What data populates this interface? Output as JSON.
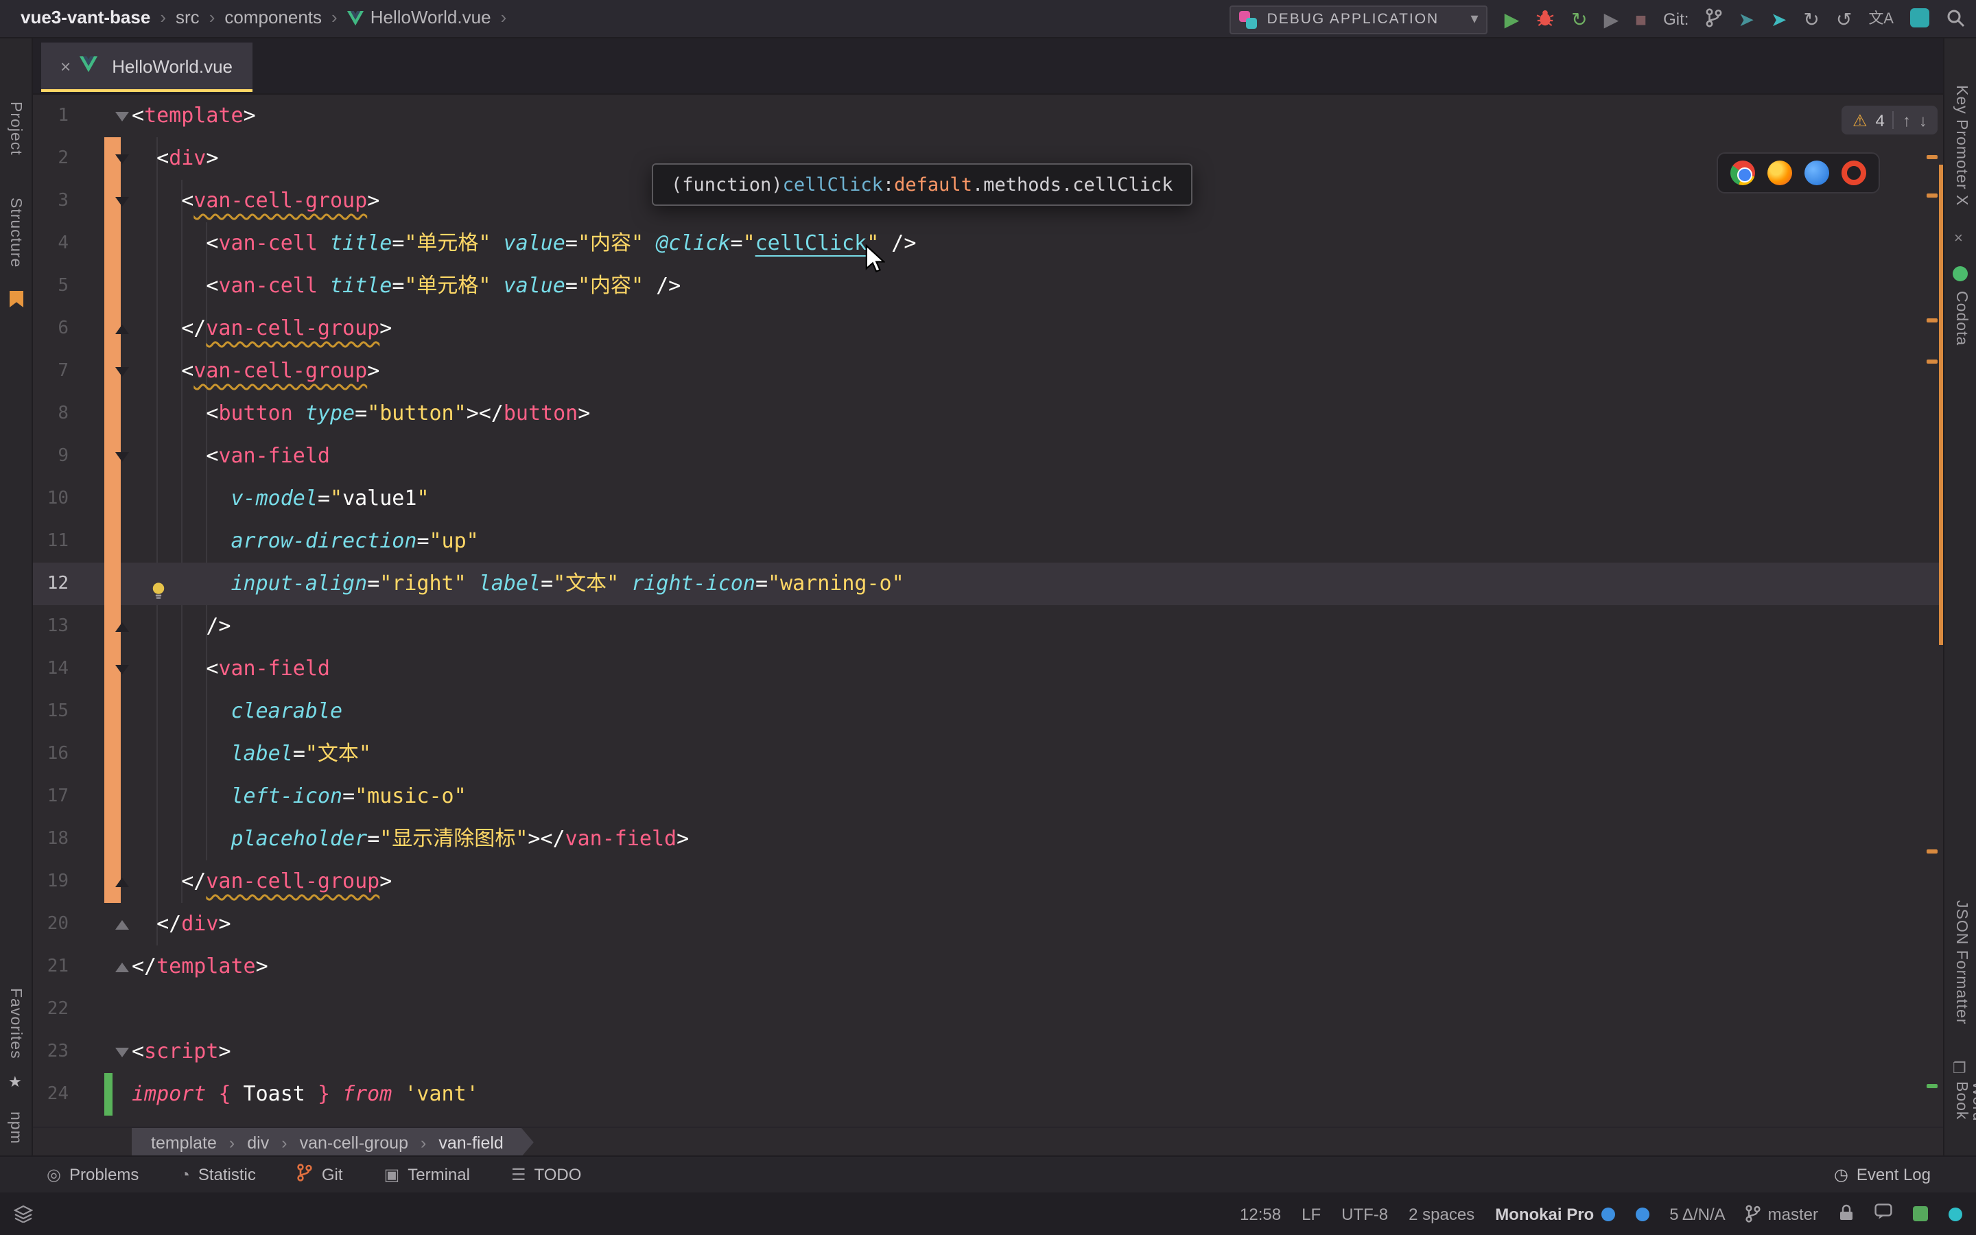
{
  "topbar": {
    "path": [
      "vue3-vant-base",
      "src",
      "components",
      "HelloWorld.vue"
    ],
    "run_config": "DEBUG APPLICATION",
    "git_label": "Git:"
  },
  "tab": {
    "label": "HelloWorld.vue"
  },
  "left_stripe": {
    "project": "Project",
    "structure": "Structure",
    "favorites": "Favorites",
    "npm": "npm"
  },
  "right_stripe": {
    "key_promoter": "Key Promoter X",
    "codota": "Codota",
    "json_formatter": "JSON Formatter",
    "word_book": "Word Book"
  },
  "tooltip": {
    "prefix": "(function) ",
    "name": "cellClick",
    "sep": ": ",
    "object": "default",
    "rest": ".methods.cellClick"
  },
  "inspection": {
    "warning_count": "4"
  },
  "icons": {
    "close": "×",
    "chevron_down": "▾",
    "play": "▶",
    "rerun": "↻",
    "stop": "■",
    "push": "➤",
    "history": "↻",
    "rollback": "↺",
    "translate": "文A",
    "warning": "⚠",
    "up": "↑",
    "down": "↓",
    "sep": "›",
    "problems": "◎",
    "statistic": "◔",
    "terminal": "▣",
    "todo": "☰",
    "event_log": "◷",
    "accent_yellow": "#ffd866",
    "accent_orange_change": "#ef9c63",
    "accent_green_change": "#59b35a"
  },
  "breadcrumbs": {
    "items": [
      "template",
      "div",
      "van-cell-group",
      "van-field"
    ]
  },
  "tool_buttons": [
    "Problems",
    "Statistic",
    "Git",
    "Terminal",
    "TODO"
  ],
  "event_log_label": "Event Log",
  "statusbar": {
    "caret": "12:58",
    "line_ending": "LF",
    "encoding": "UTF-8",
    "indent": "2 spaces",
    "theme": "Monokai Pro",
    "stats": "5 Δ/N/A",
    "branch": "master"
  },
  "editor": {
    "lines": [
      {
        "n": 1,
        "fold": "down",
        "chg": null,
        "cur": false,
        "bulb": false,
        "segs": [
          [
            "p",
            "<"
          ],
          [
            "t",
            "template"
          ],
          [
            "p",
            ">"
          ]
        ]
      },
      {
        "n": 2,
        "fold": "down",
        "chg": "orange",
        "cur": false,
        "bulb": false,
        "segs": [
          [
            "p",
            "  <"
          ],
          [
            "t",
            "div"
          ],
          [
            "p",
            ">"
          ]
        ]
      },
      {
        "n": 3,
        "fold": "down",
        "chg": "orange",
        "cur": false,
        "bulb": false,
        "segs": [
          [
            "p",
            "    <"
          ],
          [
            "w",
            "van-cell-group"
          ],
          [
            "p",
            ">"
          ]
        ]
      },
      {
        "n": 4,
        "fold": null,
        "chg": "orange",
        "cur": false,
        "bulb": false,
        "segs": [
          [
            "p",
            "      <"
          ],
          [
            "t",
            "van-cell"
          ],
          [
            "p",
            " "
          ],
          [
            "a",
            "title"
          ],
          [
            "p",
            "="
          ],
          [
            "s",
            "\"单元格\""
          ],
          [
            "p",
            " "
          ],
          [
            "a",
            "value"
          ],
          [
            "p",
            "="
          ],
          [
            "s",
            "\"内容\""
          ],
          [
            "p",
            " "
          ],
          [
            "a",
            "@click"
          ],
          [
            "p",
            "="
          ],
          [
            "s",
            "\""
          ],
          [
            "l",
            "cellClick"
          ],
          [
            "s",
            "\""
          ],
          [
            "p",
            " />"
          ]
        ]
      },
      {
        "n": 5,
        "fold": null,
        "chg": "orange",
        "cur": false,
        "bulb": false,
        "segs": [
          [
            "p",
            "      <"
          ],
          [
            "t",
            "van-cell"
          ],
          [
            "p",
            " "
          ],
          [
            "a",
            "title"
          ],
          [
            "p",
            "="
          ],
          [
            "s",
            "\"单元格\""
          ],
          [
            "p",
            " "
          ],
          [
            "a",
            "value"
          ],
          [
            "p",
            "="
          ],
          [
            "s",
            "\"内容\""
          ],
          [
            "p",
            " />"
          ]
        ]
      },
      {
        "n": 6,
        "fold": "up",
        "chg": "orange",
        "cur": false,
        "bulb": false,
        "segs": [
          [
            "p",
            "    </"
          ],
          [
            "w",
            "van-cell-group"
          ],
          [
            "p",
            ">"
          ]
        ]
      },
      {
        "n": 7,
        "fold": "down",
        "chg": "orange",
        "cur": false,
        "bulb": false,
        "segs": [
          [
            "p",
            "    <"
          ],
          [
            "w",
            "van-cell-group"
          ],
          [
            "p",
            ">"
          ]
        ]
      },
      {
        "n": 8,
        "fold": null,
        "chg": "orange",
        "cur": false,
        "bulb": false,
        "segs": [
          [
            "p",
            "      <"
          ],
          [
            "t",
            "button"
          ],
          [
            "p",
            " "
          ],
          [
            "a",
            "type"
          ],
          [
            "p",
            "="
          ],
          [
            "s",
            "\"button\""
          ],
          [
            "p",
            "></"
          ],
          [
            "t",
            "button"
          ],
          [
            "p",
            ">"
          ]
        ]
      },
      {
        "n": 9,
        "fold": "down",
        "chg": "orange",
        "cur": false,
        "bulb": false,
        "segs": [
          [
            "p",
            "      <"
          ],
          [
            "t",
            "van-field"
          ]
        ]
      },
      {
        "n": 10,
        "fold": null,
        "chg": "orange",
        "cur": false,
        "bulb": false,
        "segs": [
          [
            "p",
            "        "
          ],
          [
            "a",
            "v-model"
          ],
          [
            "p",
            "="
          ],
          [
            "s",
            "\""
          ],
          [
            "p",
            "value1"
          ],
          [
            "s",
            "\""
          ]
        ]
      },
      {
        "n": 11,
        "fold": null,
        "chg": "orange",
        "cur": false,
        "bulb": false,
        "segs": [
          [
            "p",
            "        "
          ],
          [
            "a",
            "arrow-direction"
          ],
          [
            "p",
            "="
          ],
          [
            "s",
            "\"up\""
          ]
        ]
      },
      {
        "n": 12,
        "fold": null,
        "chg": "orange",
        "cur": true,
        "bulb": true,
        "segs": [
          [
            "p",
            "        "
          ],
          [
            "a",
            "input-align"
          ],
          [
            "p",
            "="
          ],
          [
            "s",
            "\"right\""
          ],
          [
            "p",
            " "
          ],
          [
            "a",
            "label"
          ],
          [
            "p",
            "="
          ],
          [
            "s",
            "\"文本\""
          ],
          [
            "p",
            " "
          ],
          [
            "a",
            "right-icon"
          ],
          [
            "p",
            "="
          ],
          [
            "s",
            "\"warning-o\""
          ]
        ]
      },
      {
        "n": 13,
        "fold": "up",
        "chg": "orange",
        "cur": false,
        "bulb": false,
        "segs": [
          [
            "p",
            "      />"
          ]
        ]
      },
      {
        "n": 14,
        "fold": "down",
        "chg": "orange",
        "cur": false,
        "bulb": false,
        "segs": [
          [
            "p",
            "      <"
          ],
          [
            "t",
            "van-field"
          ]
        ]
      },
      {
        "n": 15,
        "fold": null,
        "chg": "orange",
        "cur": false,
        "bulb": false,
        "segs": [
          [
            "p",
            "        "
          ],
          [
            "a",
            "clearable"
          ]
        ]
      },
      {
        "n": 16,
        "fold": null,
        "chg": "orange",
        "cur": false,
        "bulb": false,
        "segs": [
          [
            "p",
            "        "
          ],
          [
            "a",
            "label"
          ],
          [
            "p",
            "="
          ],
          [
            "s",
            "\"文本\""
          ]
        ]
      },
      {
        "n": 17,
        "fold": null,
        "chg": "orange",
        "cur": false,
        "bulb": false,
        "segs": [
          [
            "p",
            "        "
          ],
          [
            "a",
            "left-icon"
          ],
          [
            "p",
            "="
          ],
          [
            "s",
            "\"music-o\""
          ]
        ]
      },
      {
        "n": 18,
        "fold": null,
        "chg": "orange",
        "cur": false,
        "bulb": false,
        "segs": [
          [
            "p",
            "        "
          ],
          [
            "a",
            "placeholder"
          ],
          [
            "p",
            "="
          ],
          [
            "s",
            "\"显示清除图标\""
          ],
          [
            "p",
            "></"
          ],
          [
            "t",
            "van-field"
          ],
          [
            "p",
            ">"
          ]
        ]
      },
      {
        "n": 19,
        "fold": "up",
        "chg": "orange",
        "cur": false,
        "bulb": false,
        "segs": [
          [
            "p",
            "    </"
          ],
          [
            "w",
            "van-cell-group"
          ],
          [
            "p",
            ">"
          ]
        ]
      },
      {
        "n": 20,
        "fold": "up",
        "chg": null,
        "cur": false,
        "bulb": false,
        "segs": [
          [
            "p",
            "  </"
          ],
          [
            "t",
            "div"
          ],
          [
            "p",
            ">"
          ]
        ]
      },
      {
        "n": 21,
        "fold": "up",
        "chg": null,
        "cur": false,
        "bulb": false,
        "segs": [
          [
            "p",
            "</"
          ],
          [
            "t",
            "template"
          ],
          [
            "p",
            ">"
          ]
        ]
      },
      {
        "n": 22,
        "fold": null,
        "chg": null,
        "cur": false,
        "bulb": false,
        "segs": []
      },
      {
        "n": 23,
        "fold": "down",
        "chg": null,
        "cur": false,
        "bulb": false,
        "segs": [
          [
            "p",
            "<"
          ],
          [
            "t",
            "script"
          ],
          [
            "p",
            ">"
          ]
        ]
      },
      {
        "n": 24,
        "fold": null,
        "chg": "green",
        "cur": false,
        "bulb": false,
        "segs": [
          [
            "k",
            "import"
          ],
          [
            "p",
            " "
          ],
          [
            "t",
            "{"
          ],
          [
            "p",
            " Toast "
          ],
          [
            "t",
            "}"
          ],
          [
            "p",
            " "
          ],
          [
            "k",
            "from"
          ],
          [
            "p",
            " "
          ],
          [
            "s",
            "'vant'"
          ]
        ]
      }
    ]
  }
}
